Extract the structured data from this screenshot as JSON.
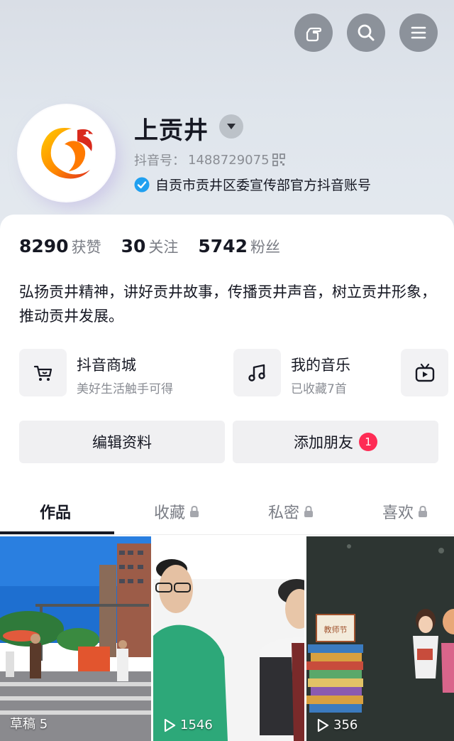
{
  "header": {
    "name": "上贡井",
    "douyin_id_label": "抖音号：",
    "douyin_id": "1488729075",
    "verification": "自贡市贡井区委宣传部官方抖音账号",
    "top_buttons": [
      "hand-pointer-icon",
      "search-icon",
      "menu-icon"
    ]
  },
  "stats": [
    {
      "num": "8290",
      "label": "获赞"
    },
    {
      "num": "30",
      "label": "关注"
    },
    {
      "num": "5742",
      "label": "粉丝"
    }
  ],
  "bio": "弘扬贡井精神，讲好贡井故事，传播贡井声音，树立贡井形象，推动贡井发展。",
  "services": [
    {
      "title": "抖音商城",
      "subtitle": "美好生活触手可得",
      "icon": "shopping-cart-icon"
    },
    {
      "title": "我的音乐",
      "subtitle": "已收藏7首",
      "icon": "music-note-icon"
    },
    {
      "title": "",
      "subtitle": "",
      "icon": "tv-icon"
    }
  ],
  "actions": {
    "edit_profile": "编辑资料",
    "add_friends": "添加朋友",
    "add_friends_badge": "1"
  },
  "tabs": [
    {
      "label": "作品",
      "locked": false,
      "active": true
    },
    {
      "label": "收藏",
      "locked": true,
      "active": false
    },
    {
      "label": "私密",
      "locked": true,
      "active": false
    },
    {
      "label": "喜欢",
      "locked": true,
      "active": false
    }
  ],
  "videos": [
    {
      "label": "草稿 5",
      "type": "draft"
    },
    {
      "label": "1546",
      "type": "play-count"
    },
    {
      "label": "356",
      "type": "play-count"
    }
  ],
  "thumb3_sign": "教师节",
  "colors": {
    "accent_red": "#fe2c55",
    "verify_blue": "#20a0f0"
  }
}
